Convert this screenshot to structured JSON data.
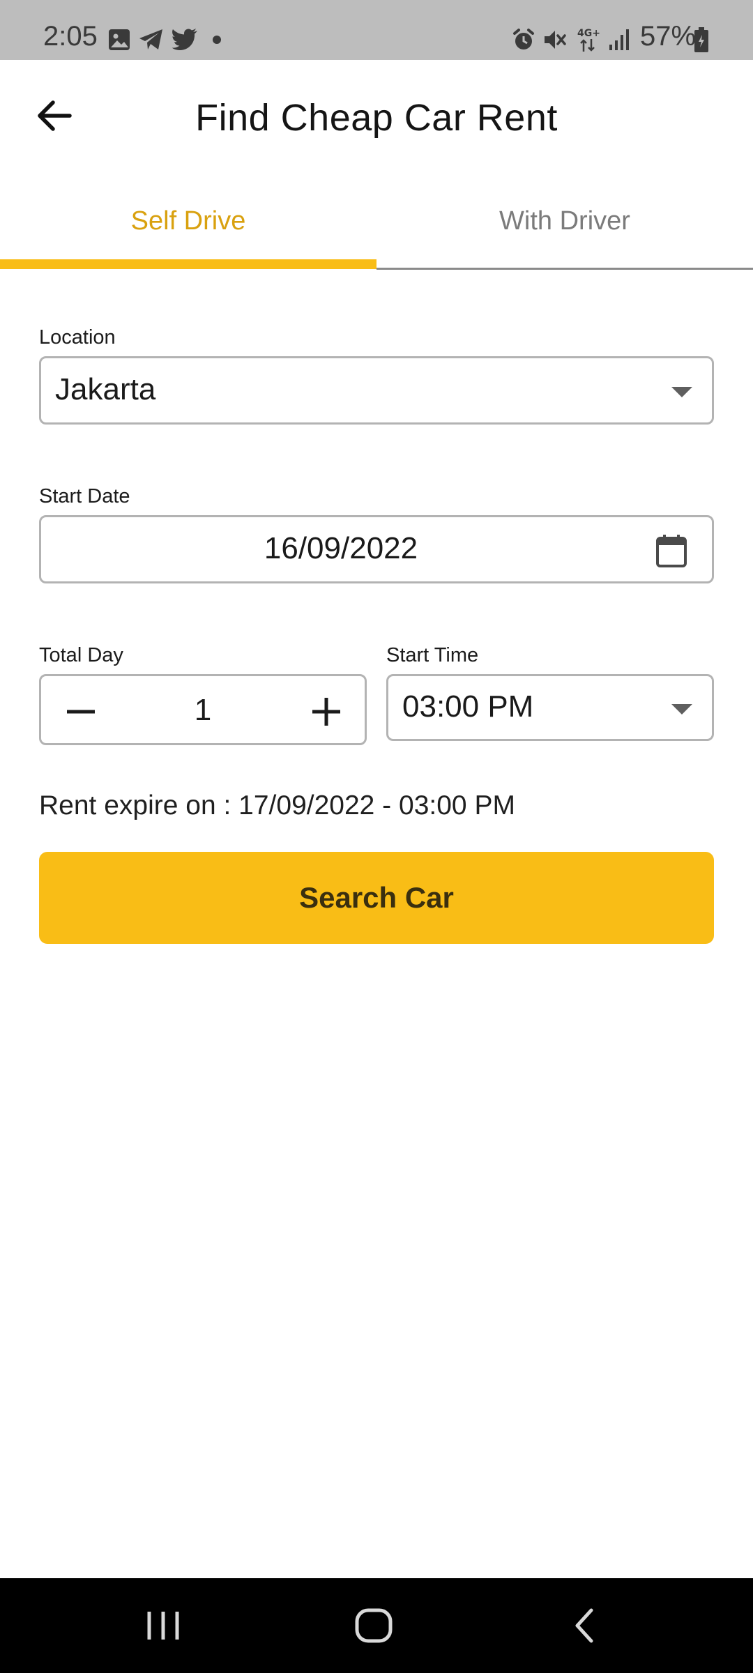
{
  "status_bar": {
    "time": "2:05",
    "battery": "57%",
    "icons_left": [
      "image-icon",
      "telegram-icon",
      "twitter-icon",
      "dot-icon"
    ],
    "icons_right": [
      "alarm-icon",
      "mute-icon",
      "network-4g-icon",
      "signal-icon",
      "battery-icon"
    ]
  },
  "header": {
    "title": "Find Cheap Car Rent"
  },
  "tabs": [
    {
      "label": "Self Drive",
      "active": true
    },
    {
      "label": "With Driver",
      "active": false
    }
  ],
  "form": {
    "location": {
      "label": "Location",
      "value": "Jakarta"
    },
    "start_date": {
      "label": "Start Date",
      "value": "16/09/2022"
    },
    "total_day": {
      "label": "Total Day",
      "value": "1"
    },
    "start_time": {
      "label": "Start Time",
      "value": "03:00 PM"
    }
  },
  "expire_text": "Rent expire on : 17/09/2022 - 03:00 PM",
  "search_button": {
    "label": "Search Car"
  },
  "colors": {
    "accent": "#f9bd16",
    "active_tab_text": "#d9a10f"
  }
}
